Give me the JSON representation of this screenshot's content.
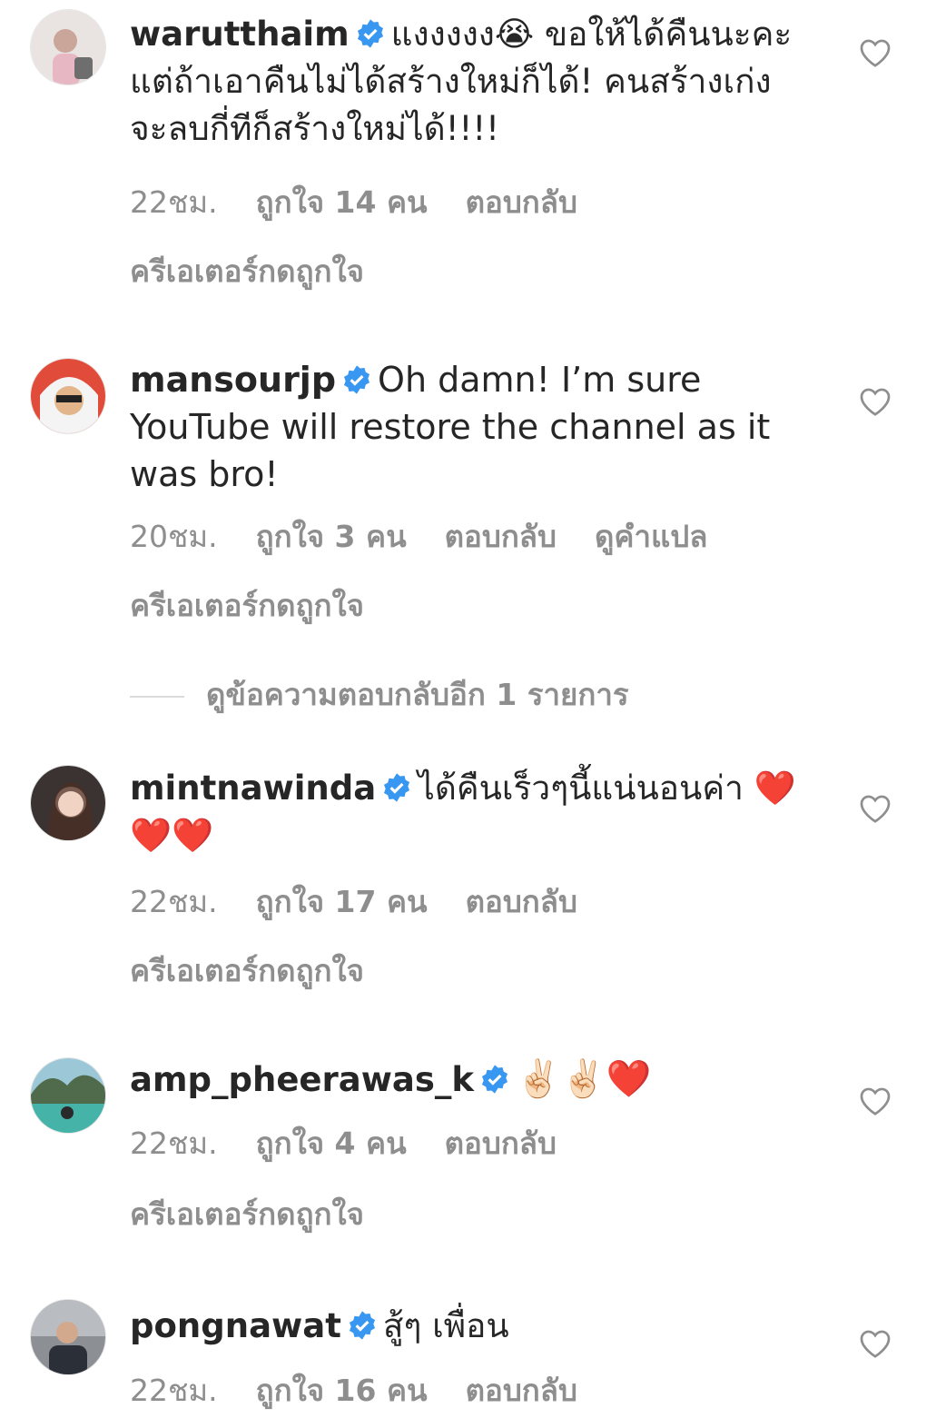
{
  "comments": [
    {
      "username": "warutthaim",
      "text": "แงงงงง😭 ขอให้ได้คืนนะคะ แต่ถ้าเอาคืนไม่ได้สร้างใหม่ก็ได้! คนสร้างเก่ง จะลบกี่ทีก็สร้างใหม่ได้!!!!",
      "time": "22ชม.",
      "likes": "ถูกใจ 14 คน",
      "reply": "ตอบกลับ",
      "creator_liked": "ครีเอเตอร์กดถูกใจ"
    },
    {
      "username": "mansourjp",
      "text": "Oh damn! I’m sure YouTube will restore the channel as it was bro!",
      "time": "20ชม.",
      "likes": "ถูกใจ 3 คน",
      "reply": "ตอบกลับ",
      "translate": "ดูคำแปล",
      "creator_liked": "ครีเอเตอร์กดถูกใจ"
    },
    {
      "username": "mintnawinda",
      "text": "ได้คืนเร็วๆนี้แน่นอนค่า ❤️❤️❤️",
      "time": "22ชม.",
      "likes": "ถูกใจ 17 คน",
      "reply": "ตอบกลับ",
      "creator_liked": "ครีเอเตอร์กดถูกใจ"
    },
    {
      "username": "amp_pheerawas_k",
      "text": "✌🏻✌🏻❤️",
      "time": "22ชม.",
      "likes": "ถูกใจ 4 คน",
      "reply": "ตอบกลับ",
      "creator_liked": "ครีเอเตอร์กดถูกใจ"
    },
    {
      "username": "pongnawat",
      "text": "สู้ๆ เพื่อน",
      "time": "22ชม.",
      "likes": "ถูกใจ 16 คน",
      "reply": "ตอบกลับ"
    }
  ],
  "view_more_replies": "ดูข้อความตอบกลับอีก 1 รายการ",
  "colors": {
    "verified": "#3897f0",
    "secondary": "#8e8e8e",
    "primary": "#262626"
  },
  "icons": {
    "verified": "verified-badge-icon",
    "like": "heart-outline-icon"
  }
}
